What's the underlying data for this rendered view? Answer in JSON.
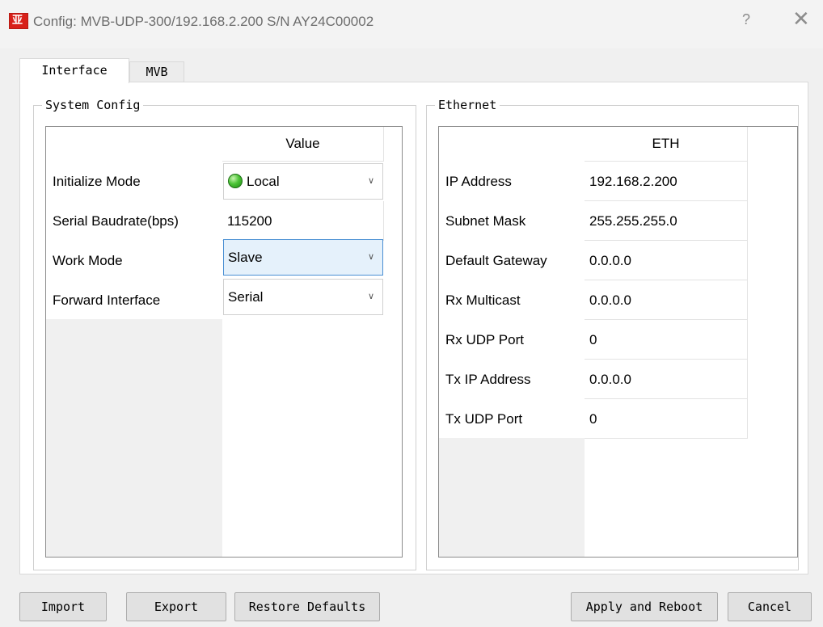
{
  "window": {
    "title": "Config: MVB-UDP-300/192.168.2.200  S/N AY24C00002",
    "icon_glyph": "亚",
    "help_label": "?",
    "close_label": "✕",
    "brand_color": "#d8211a"
  },
  "tabs": [
    {
      "label": "Interface",
      "active": true
    },
    {
      "label": "MVB",
      "active": false
    }
  ],
  "system_config": {
    "title": "System Config",
    "column_header": "Value",
    "rows": [
      {
        "label": "Initialize Mode",
        "value": "Local",
        "type": "combo",
        "status_icon": "green-led-icon"
      },
      {
        "label": "Serial Baudrate(bps)",
        "value": "115200",
        "type": "text"
      },
      {
        "label": "Work Mode",
        "value": "Slave",
        "type": "combo",
        "focused": true
      },
      {
        "label": "Forward Interface",
        "value": "Serial",
        "type": "combo"
      }
    ]
  },
  "ethernet": {
    "title": "Ethernet",
    "column_header": "ETH",
    "rows": [
      {
        "label": "IP Address",
        "value": "192.168.2.200"
      },
      {
        "label": "Subnet Mask",
        "value": "255.255.255.0"
      },
      {
        "label": "Default Gateway",
        "value": "0.0.0.0"
      },
      {
        "label": "Rx Multicast",
        "value": "0.0.0.0"
      },
      {
        "label": "Rx UDP Port",
        "value": "0"
      },
      {
        "label": "Tx IP Address",
        "value": "0.0.0.0"
      },
      {
        "label": "Tx UDP Port",
        "value": "0"
      }
    ]
  },
  "buttons": {
    "import": "Import",
    "export": "Export",
    "restore_defaults": "Restore Defaults",
    "apply_reboot": "Apply and Reboot",
    "cancel": "Cancel"
  }
}
